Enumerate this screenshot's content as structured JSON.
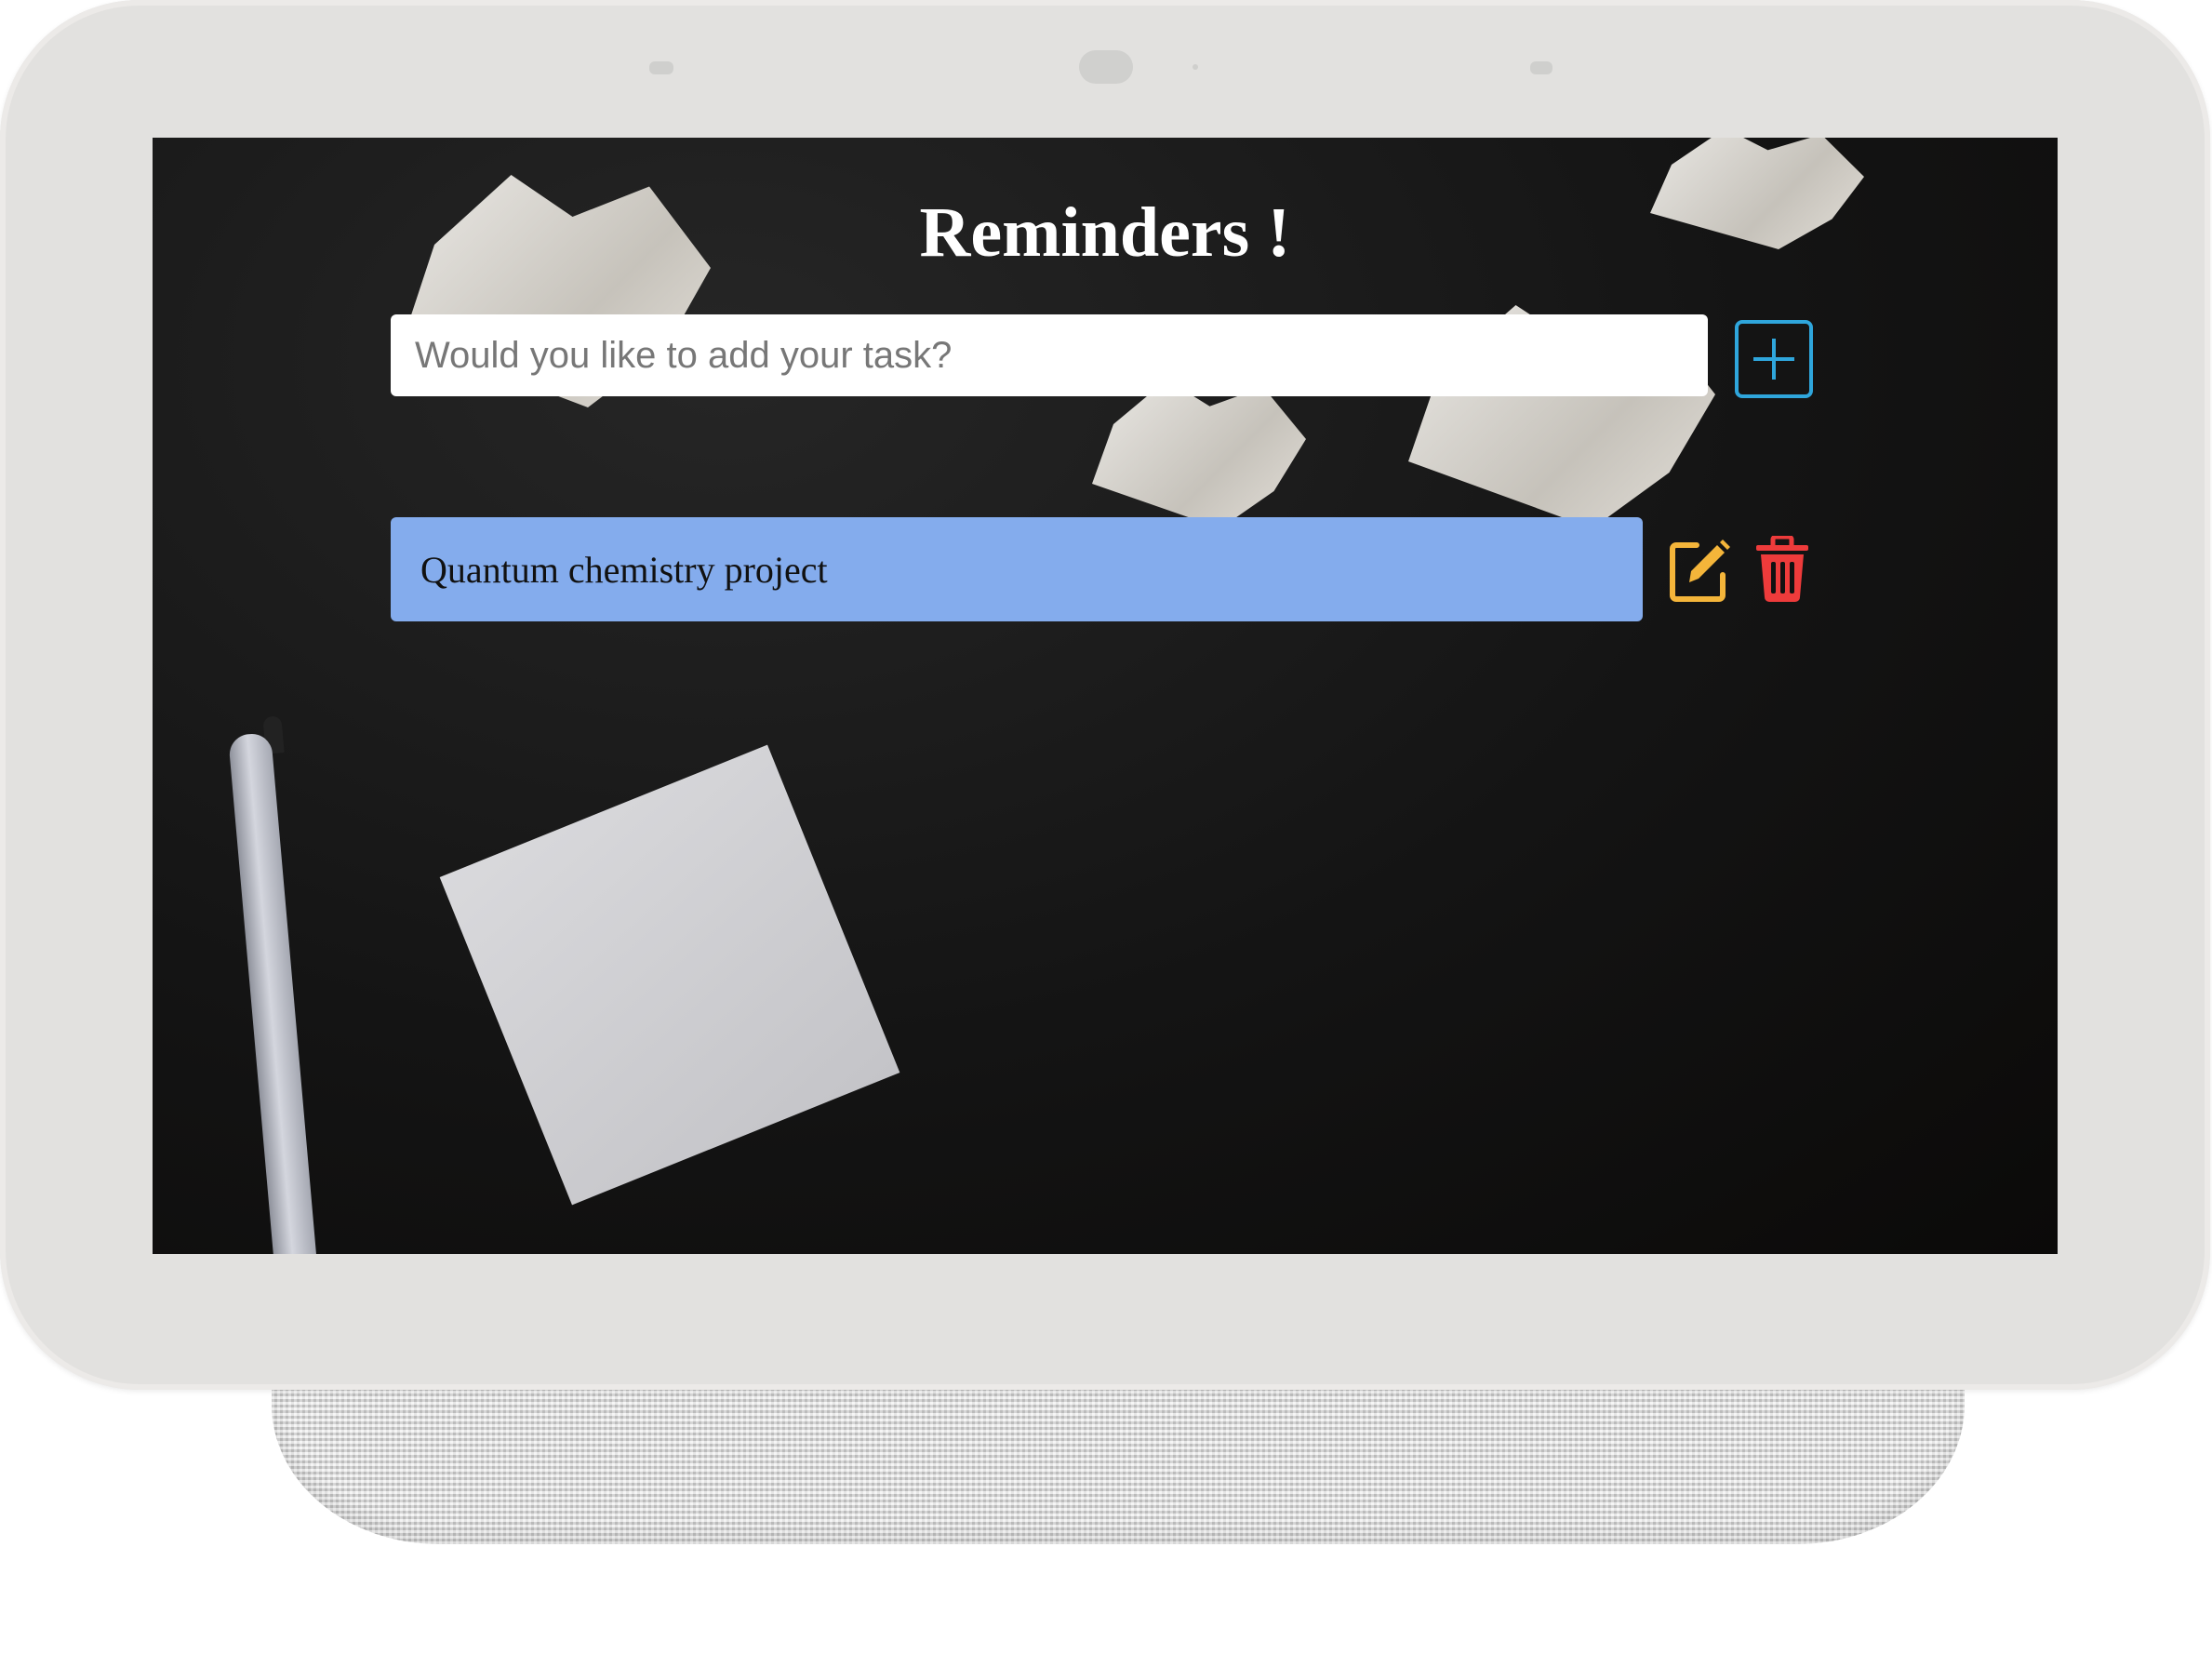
{
  "app": {
    "title": "Reminders !"
  },
  "input": {
    "placeholder": "Would you like to add your task?",
    "value": ""
  },
  "tasks": [
    {
      "text": "Quantum chemistry project"
    }
  ],
  "icons": {
    "add": "plus-square-icon",
    "edit": "edit-icon",
    "delete": "trash-icon"
  },
  "colors": {
    "title": "#ffffff",
    "task_background": "#84aced",
    "add_accent": "#2fa6dc",
    "edit_accent": "#f4b53a",
    "delete_accent": "#ee3b3b"
  }
}
